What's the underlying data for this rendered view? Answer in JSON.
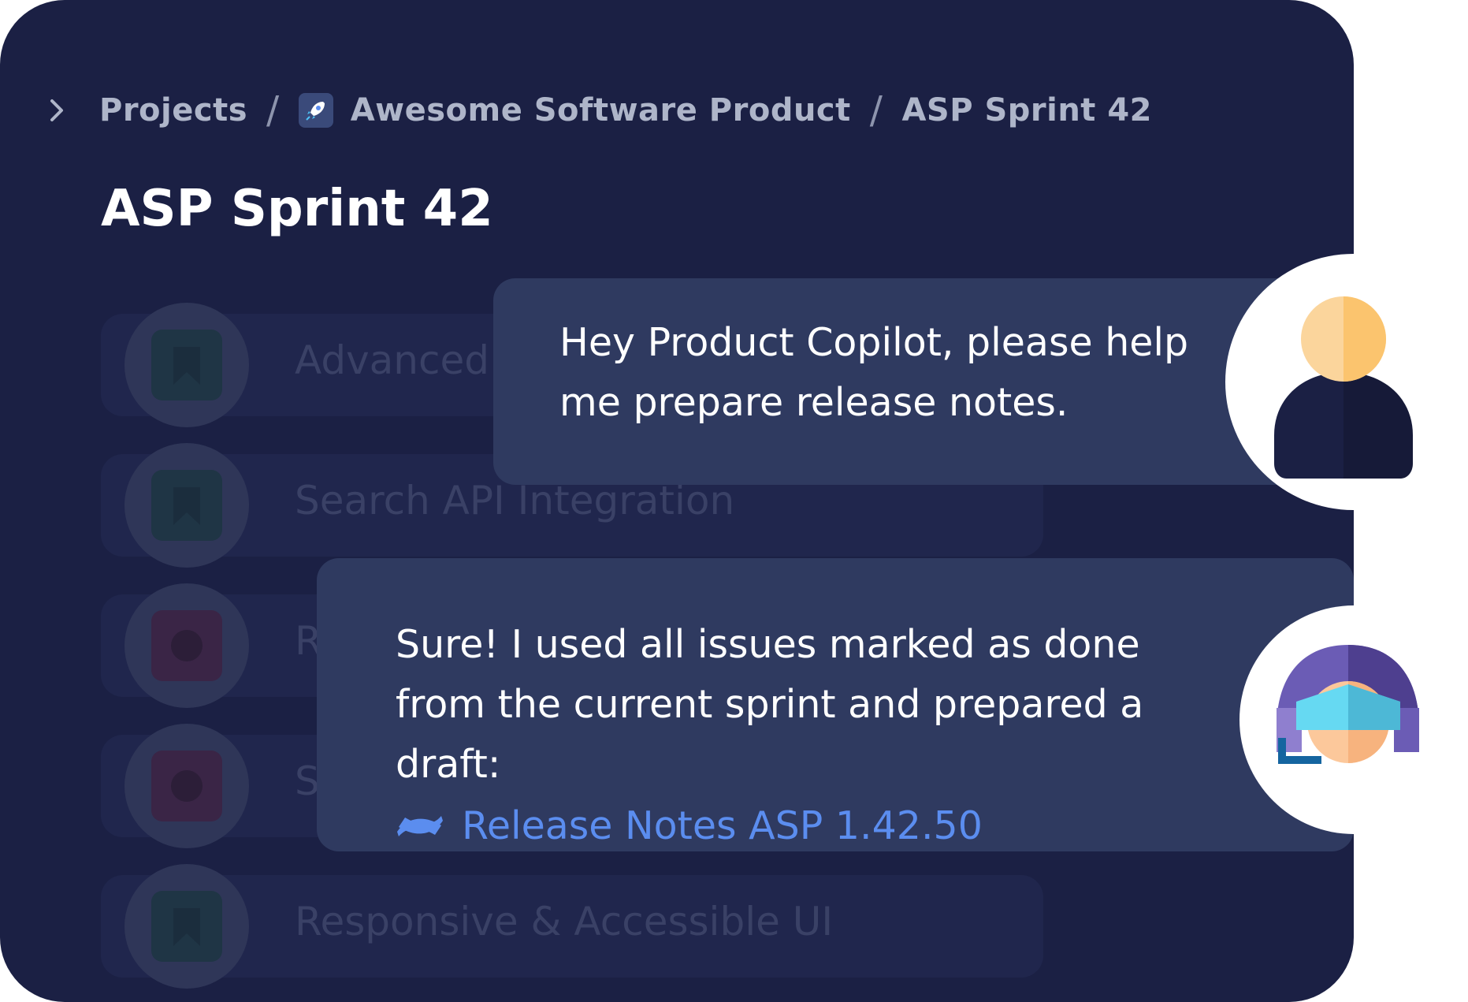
{
  "breadcrumb": {
    "items": [
      "Projects",
      "Awesome Software Product",
      "ASP Sprint 42"
    ],
    "separator": "/"
  },
  "page": {
    "title": "ASP Sprint 42"
  },
  "issues": [
    {
      "title": "Advanced",
      "type": "story"
    },
    {
      "title": "Search API Integration",
      "type": "story"
    },
    {
      "title": "R",
      "type": "bug"
    },
    {
      "title": "S",
      "type": "bug"
    },
    {
      "title": "Responsive & Accessible UI",
      "type": "story"
    }
  ],
  "chat": {
    "user_message": "Hey Product Copilot, please help me prepare release notes.",
    "bot_message": "Sure! I used all issues marked as done from the current sprint and prepared a draft:",
    "bot_link": "Release Notes ASP 1.42.50"
  },
  "colors": {
    "card_bg": "#1b2044",
    "bubble_bg": "#2f3a60",
    "link": "#5b8def",
    "muted_text": "#aeb5c9"
  },
  "icons": [
    "chevron-right-icon",
    "rocket-icon",
    "bookmark-icon",
    "bug-icon",
    "confluence-icon",
    "user-avatar",
    "bot-avatar"
  ]
}
